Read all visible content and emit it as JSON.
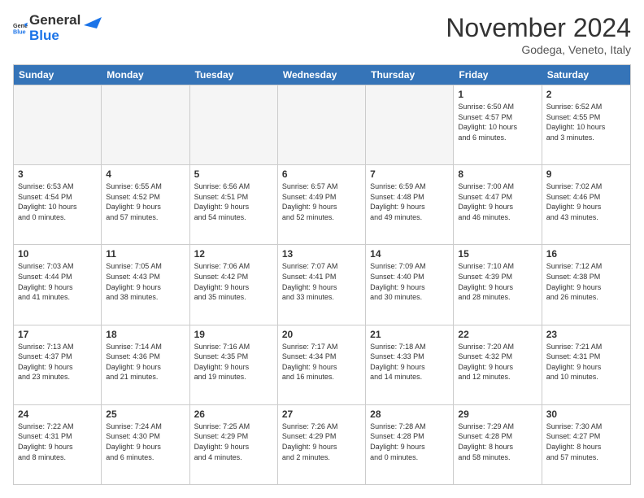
{
  "header": {
    "logo_general": "General",
    "logo_blue": "Blue",
    "month_title": "November 2024",
    "location": "Godega, Veneto, Italy"
  },
  "calendar": {
    "days_of_week": [
      "Sunday",
      "Monday",
      "Tuesday",
      "Wednesday",
      "Thursday",
      "Friday",
      "Saturday"
    ],
    "rows": [
      [
        {
          "day": "",
          "info": ""
        },
        {
          "day": "",
          "info": ""
        },
        {
          "day": "",
          "info": ""
        },
        {
          "day": "",
          "info": ""
        },
        {
          "day": "",
          "info": ""
        },
        {
          "day": "1",
          "info": "Sunrise: 6:50 AM\nSunset: 4:57 PM\nDaylight: 10 hours\nand 6 minutes."
        },
        {
          "day": "2",
          "info": "Sunrise: 6:52 AM\nSunset: 4:55 PM\nDaylight: 10 hours\nand 3 minutes."
        }
      ],
      [
        {
          "day": "3",
          "info": "Sunrise: 6:53 AM\nSunset: 4:54 PM\nDaylight: 10 hours\nand 0 minutes."
        },
        {
          "day": "4",
          "info": "Sunrise: 6:55 AM\nSunset: 4:52 PM\nDaylight: 9 hours\nand 57 minutes."
        },
        {
          "day": "5",
          "info": "Sunrise: 6:56 AM\nSunset: 4:51 PM\nDaylight: 9 hours\nand 54 minutes."
        },
        {
          "day": "6",
          "info": "Sunrise: 6:57 AM\nSunset: 4:49 PM\nDaylight: 9 hours\nand 52 minutes."
        },
        {
          "day": "7",
          "info": "Sunrise: 6:59 AM\nSunset: 4:48 PM\nDaylight: 9 hours\nand 49 minutes."
        },
        {
          "day": "8",
          "info": "Sunrise: 7:00 AM\nSunset: 4:47 PM\nDaylight: 9 hours\nand 46 minutes."
        },
        {
          "day": "9",
          "info": "Sunrise: 7:02 AM\nSunset: 4:46 PM\nDaylight: 9 hours\nand 43 minutes."
        }
      ],
      [
        {
          "day": "10",
          "info": "Sunrise: 7:03 AM\nSunset: 4:44 PM\nDaylight: 9 hours\nand 41 minutes."
        },
        {
          "day": "11",
          "info": "Sunrise: 7:05 AM\nSunset: 4:43 PM\nDaylight: 9 hours\nand 38 minutes."
        },
        {
          "day": "12",
          "info": "Sunrise: 7:06 AM\nSunset: 4:42 PM\nDaylight: 9 hours\nand 35 minutes."
        },
        {
          "day": "13",
          "info": "Sunrise: 7:07 AM\nSunset: 4:41 PM\nDaylight: 9 hours\nand 33 minutes."
        },
        {
          "day": "14",
          "info": "Sunrise: 7:09 AM\nSunset: 4:40 PM\nDaylight: 9 hours\nand 30 minutes."
        },
        {
          "day": "15",
          "info": "Sunrise: 7:10 AM\nSunset: 4:39 PM\nDaylight: 9 hours\nand 28 minutes."
        },
        {
          "day": "16",
          "info": "Sunrise: 7:12 AM\nSunset: 4:38 PM\nDaylight: 9 hours\nand 26 minutes."
        }
      ],
      [
        {
          "day": "17",
          "info": "Sunrise: 7:13 AM\nSunset: 4:37 PM\nDaylight: 9 hours\nand 23 minutes."
        },
        {
          "day": "18",
          "info": "Sunrise: 7:14 AM\nSunset: 4:36 PM\nDaylight: 9 hours\nand 21 minutes."
        },
        {
          "day": "19",
          "info": "Sunrise: 7:16 AM\nSunset: 4:35 PM\nDaylight: 9 hours\nand 19 minutes."
        },
        {
          "day": "20",
          "info": "Sunrise: 7:17 AM\nSunset: 4:34 PM\nDaylight: 9 hours\nand 16 minutes."
        },
        {
          "day": "21",
          "info": "Sunrise: 7:18 AM\nSunset: 4:33 PM\nDaylight: 9 hours\nand 14 minutes."
        },
        {
          "day": "22",
          "info": "Sunrise: 7:20 AM\nSunset: 4:32 PM\nDaylight: 9 hours\nand 12 minutes."
        },
        {
          "day": "23",
          "info": "Sunrise: 7:21 AM\nSunset: 4:31 PM\nDaylight: 9 hours\nand 10 minutes."
        }
      ],
      [
        {
          "day": "24",
          "info": "Sunrise: 7:22 AM\nSunset: 4:31 PM\nDaylight: 9 hours\nand 8 minutes."
        },
        {
          "day": "25",
          "info": "Sunrise: 7:24 AM\nSunset: 4:30 PM\nDaylight: 9 hours\nand 6 minutes."
        },
        {
          "day": "26",
          "info": "Sunrise: 7:25 AM\nSunset: 4:29 PM\nDaylight: 9 hours\nand 4 minutes."
        },
        {
          "day": "27",
          "info": "Sunrise: 7:26 AM\nSunset: 4:29 PM\nDaylight: 9 hours\nand 2 minutes."
        },
        {
          "day": "28",
          "info": "Sunrise: 7:28 AM\nSunset: 4:28 PM\nDaylight: 9 hours\nand 0 minutes."
        },
        {
          "day": "29",
          "info": "Sunrise: 7:29 AM\nSunset: 4:28 PM\nDaylight: 8 hours\nand 58 minutes."
        },
        {
          "day": "30",
          "info": "Sunrise: 7:30 AM\nSunset: 4:27 PM\nDaylight: 8 hours\nand 57 minutes."
        }
      ]
    ]
  }
}
